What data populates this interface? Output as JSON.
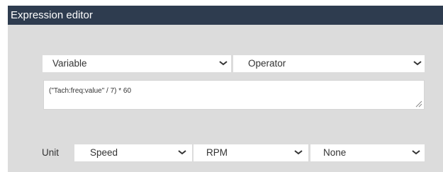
{
  "window": {
    "title": "Expression editor"
  },
  "variable_select": {
    "value": "Variable",
    "icon": "chevron-down-icon"
  },
  "operator_select": {
    "value": "Operator",
    "icon": "chevron-down-icon"
  },
  "expression": {
    "value": "(\"Tach:freq:value\" / 7) * 60"
  },
  "unit": {
    "label": "Unit",
    "quantity": "Speed",
    "unit": "RPM",
    "modifier": "None"
  }
}
